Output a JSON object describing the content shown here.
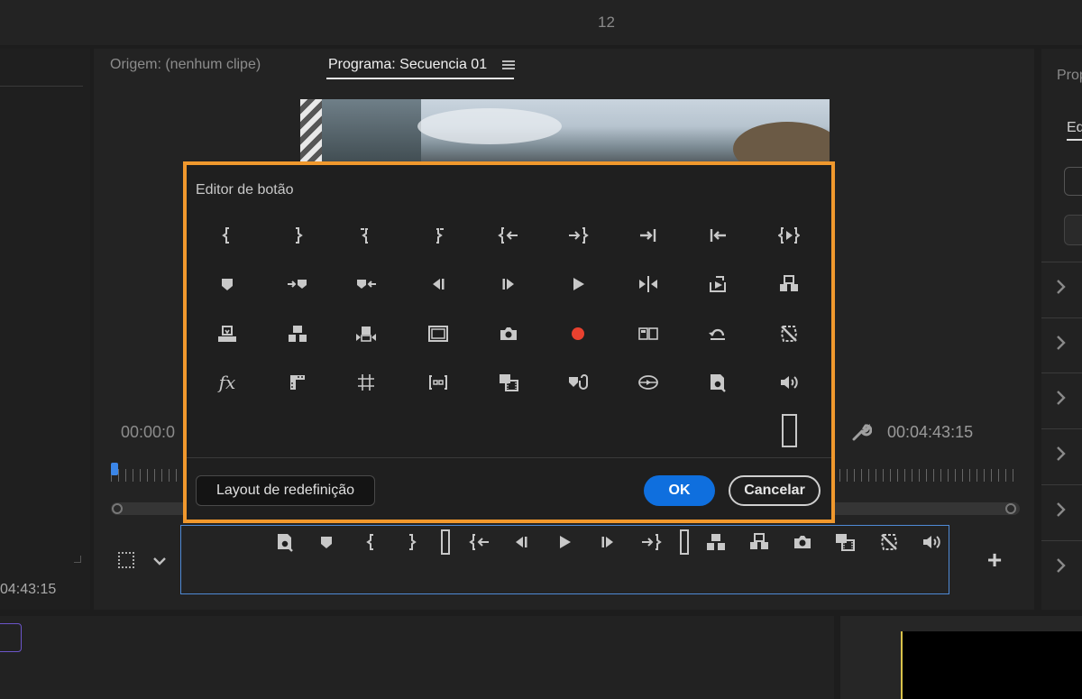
{
  "top_bar": {
    "center_label": "12"
  },
  "monitor": {
    "tab_source": "Origem: (nenhum clipe)",
    "tab_program": "Programa: Secuencia 01",
    "timecode_left": "00:00:0",
    "timecode_right": "00:04:43:15"
  },
  "left_panel": {
    "timecode": "04:43:15"
  },
  "right_panel": {
    "title": "Prop",
    "tab": "Edi"
  },
  "dialog": {
    "title": "Editor de botão",
    "reset_label": "Layout de redefinição",
    "ok_label": "OK",
    "cancel_label": "Cancelar",
    "accent_color": "#f0982d",
    "ok_color": "#0f6fde",
    "buttons": [
      [
        "mark-in-icon",
        "mark-out-icon",
        "clear-in-icon",
        "clear-out-icon",
        "go-to-in-icon",
        "go-to-out-icon",
        "go-to-next-edit-icon",
        "go-to-prev-edit-icon",
        "play-in-to-out-icon"
      ],
      [
        "add-marker-icon",
        "go-to-next-marker-icon",
        "go-to-prev-marker-icon",
        "step-back-icon",
        "step-forward-icon",
        "play-stop-icon",
        "play-around-icon",
        "export-frame-icon",
        "extract-icon"
      ],
      [
        "overwrite-icon",
        "lift-icon",
        "insert-icon",
        "safe-margins-icon",
        "camera-icon",
        "record-icon",
        "multicam-icon",
        "loop-icon",
        "proxy-toggle-icon"
      ],
      [
        "fx-icon",
        "comparison-view-icon",
        "grid-icon",
        "trim-icon",
        "multi-camera-view-icon",
        "marker-link-icon",
        "vr-video-icon",
        "playback-settings-icon",
        "audio-volume-icon"
      ]
    ],
    "spacer_icon": "spacer-icon"
  },
  "transport_bar": {
    "buttons": [
      "playback-settings-icon",
      "add-marker-icon",
      "mark-in-icon",
      "mark-out-icon",
      "spacer-icon",
      "go-to-in-icon",
      "step-back-icon",
      "play-stop-icon",
      "step-forward-icon",
      "go-to-out-icon",
      "spacer-icon",
      "lift-icon",
      "extract-icon",
      "camera-icon",
      "multi-camera-view-icon",
      "proxy-toggle-icon",
      "audio-volume-icon"
    ],
    "add_button": "+"
  }
}
